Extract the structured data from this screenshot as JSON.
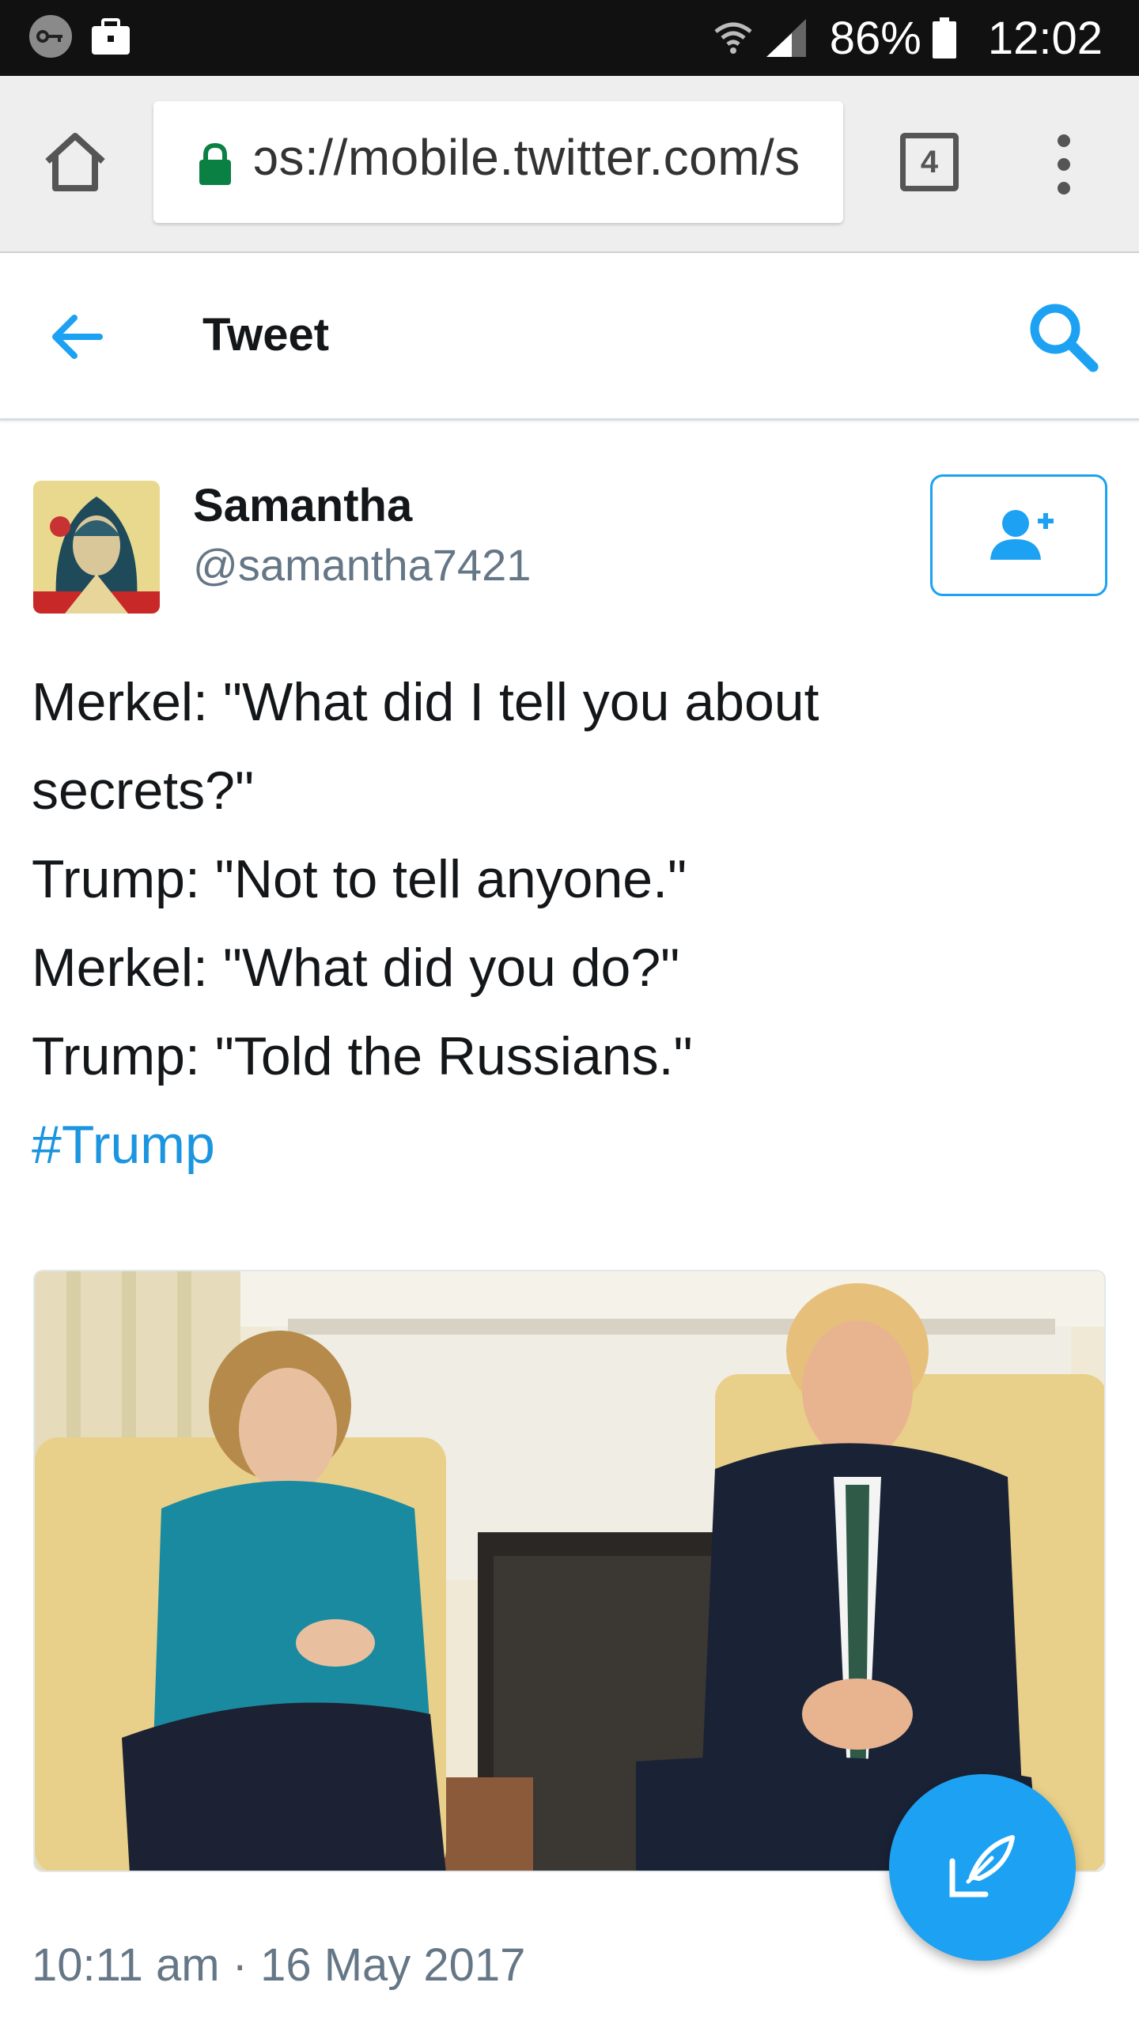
{
  "status_bar": {
    "battery_percent": "86%",
    "time": "12:02",
    "icons": [
      "vpn-key-icon",
      "briefcase-icon",
      "wifi-icon",
      "signal-icon",
      "battery-icon"
    ]
  },
  "browser": {
    "url": "ɔs://mobile.twitter.com/s",
    "tab_count": "4",
    "icons": [
      "home-icon",
      "lock-icon",
      "tabs-icon",
      "overflow-menu-icon"
    ]
  },
  "header": {
    "title": "Tweet",
    "icons": [
      "back-arrow-icon",
      "search-icon"
    ]
  },
  "tweet": {
    "author_name": "Samantha",
    "author_handle": "@samantha7421",
    "lines": [
      "Merkel: \"What did I tell you about",
      "secrets?\"",
      "Trump: \"Not to tell anyone.\"",
      "Merkel: \"What did you do?\"",
      "Trump: \"Told the Russians.\""
    ],
    "hashtag": "#Trump",
    "timestamp": "10:11 am · 16 May 2017"
  },
  "colors": {
    "accent": "#1da1f2",
    "hashtag": "#1b95e0",
    "secondary_text": "#657786",
    "lock_green": "#0b8043"
  },
  "fab": {
    "icon": "compose-tweet-icon"
  }
}
